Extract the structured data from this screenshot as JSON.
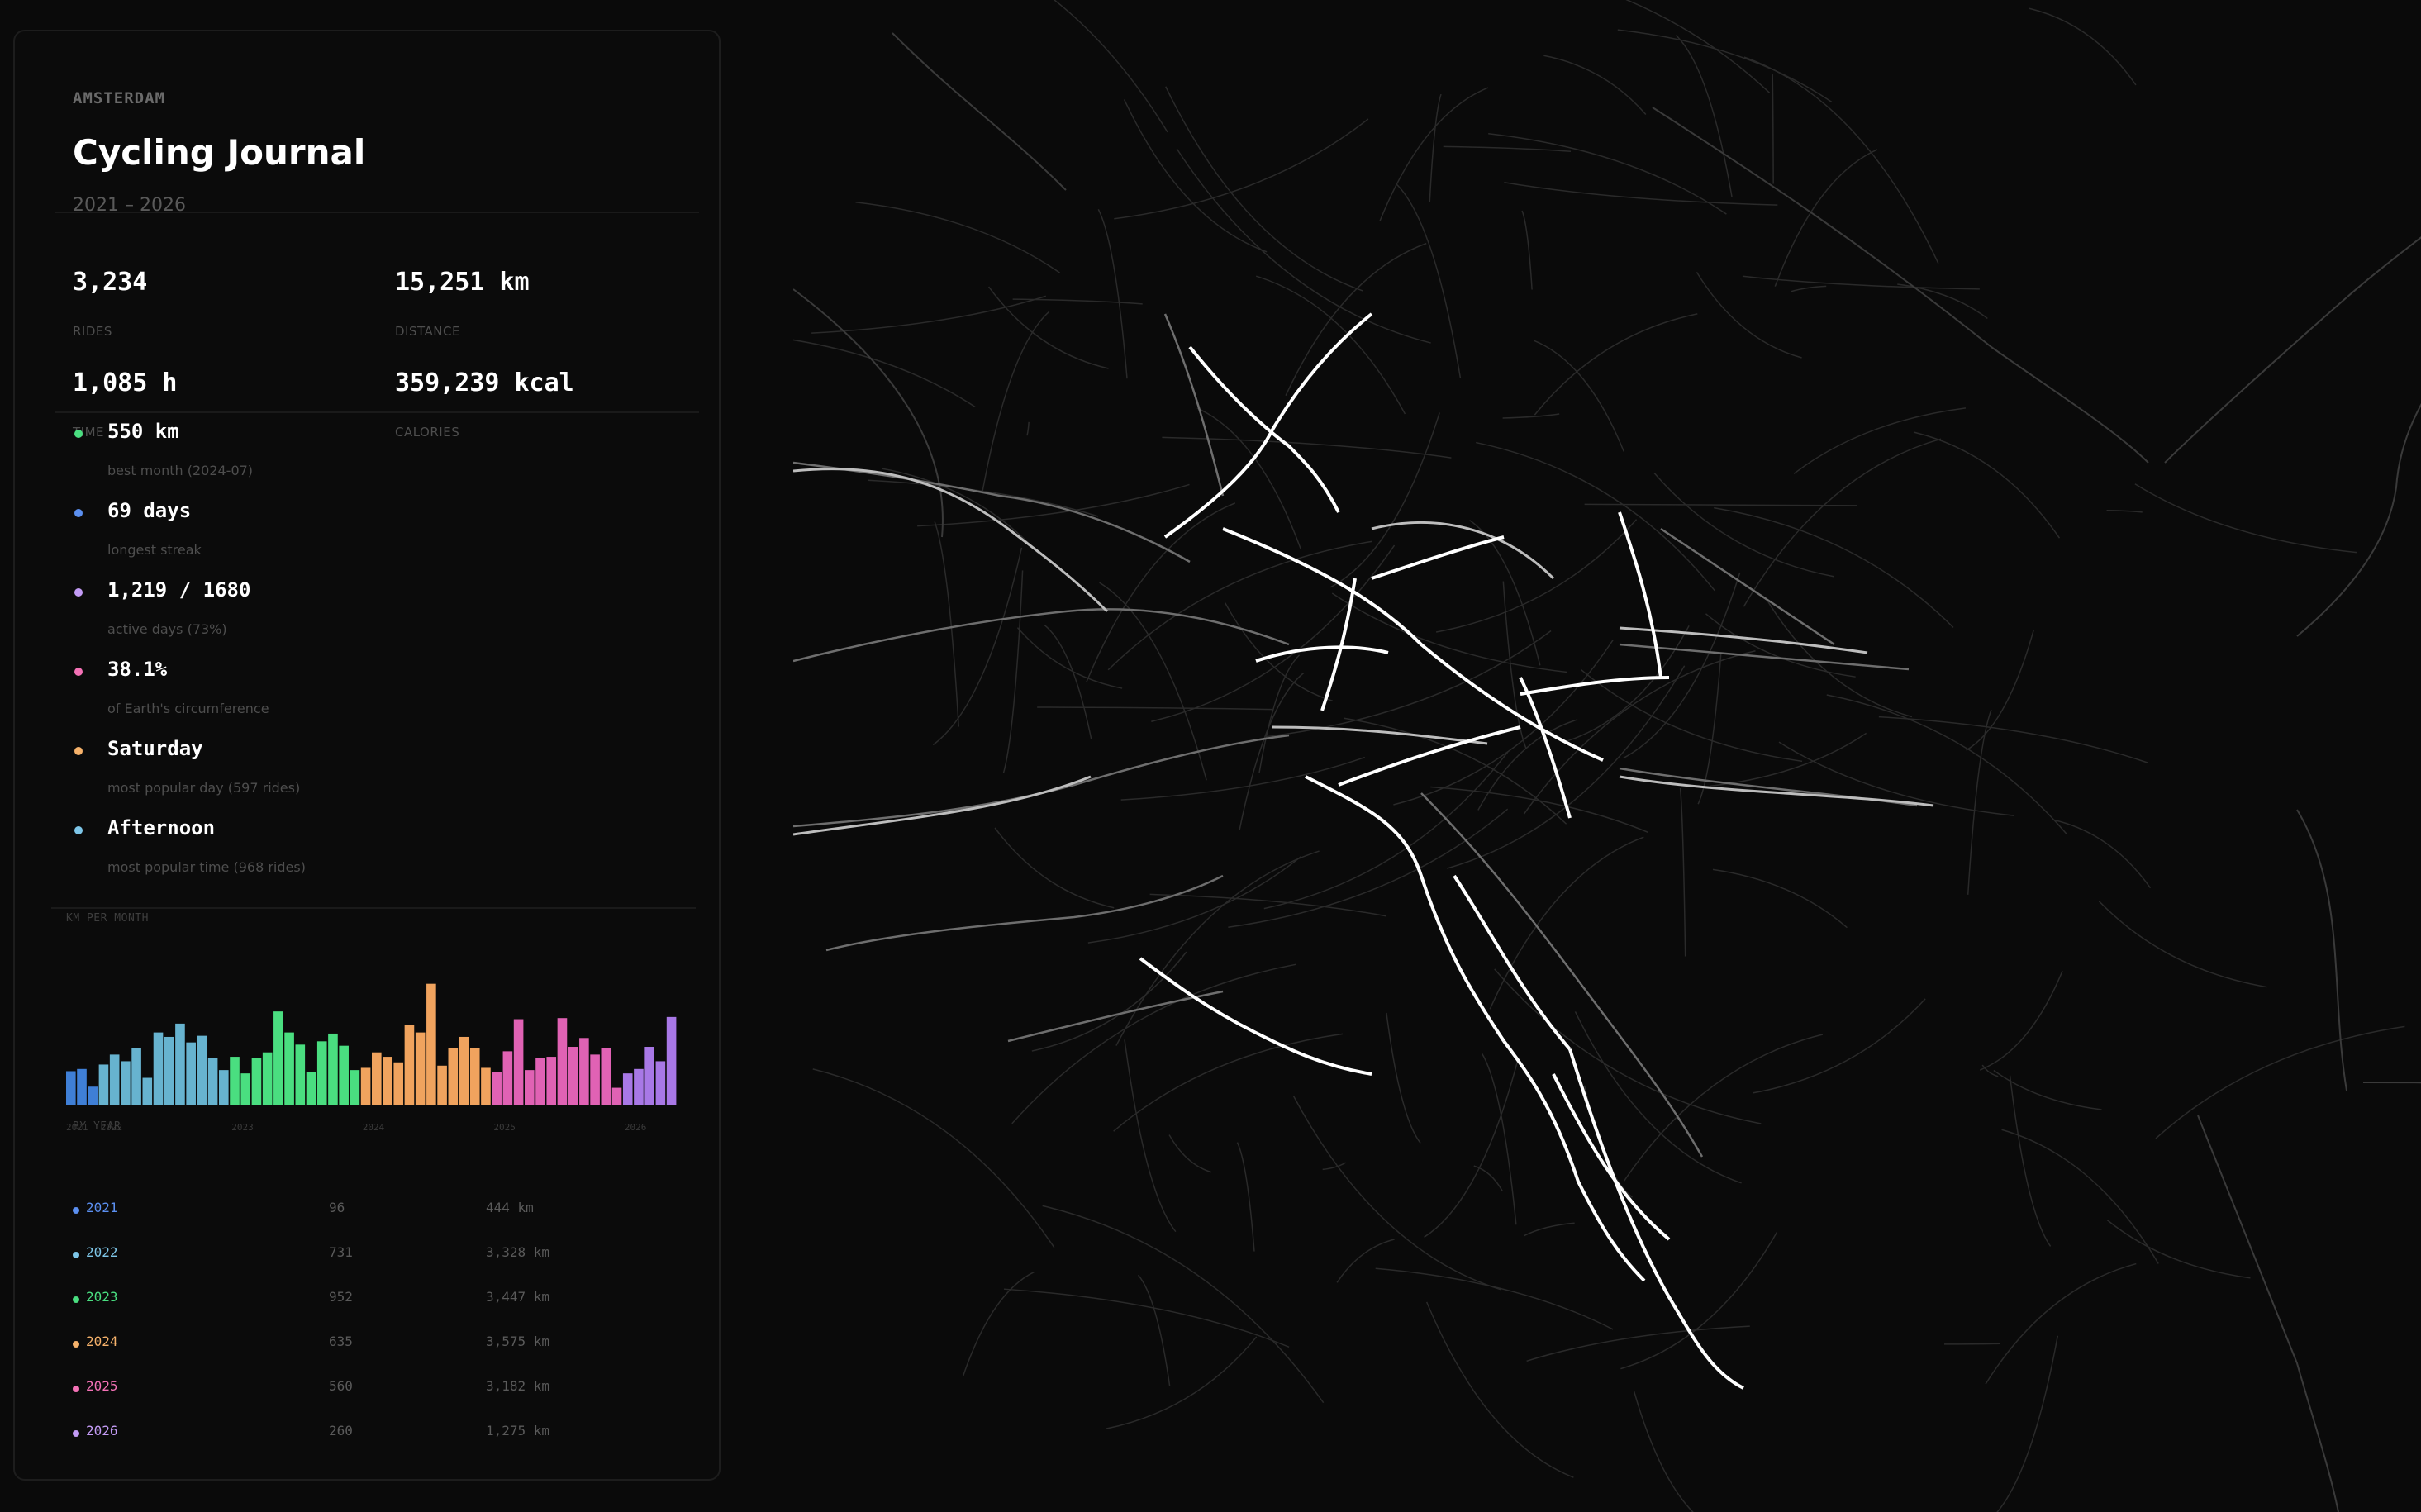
{
  "panel": {
    "city": "AMSTERDAM",
    "title": "Cycling Journal",
    "period": "2021 – 2026"
  },
  "stats": [
    {
      "value": "3,234",
      "label": "RIDES"
    },
    {
      "value": "15,251 km",
      "label": "DISTANCE"
    },
    {
      "value": "1,085 h",
      "label": "TIME"
    },
    {
      "value": "359,239 kcal",
      "label": "CALORIES"
    }
  ],
  "highlights": [
    {
      "value": "550 km",
      "label": "best month  (2024-07)",
      "color": "#4ade80"
    },
    {
      "value": "69 days",
      "label": "longest streak",
      "color": "#5b8ff0"
    },
    {
      "value": "1,219 / 1680",
      "label": "active days  (73%)",
      "color": "#c39bf5"
    },
    {
      "value": "38.1%",
      "label": "of Earth's circumference",
      "color": "#f472b6"
    },
    {
      "value": "Saturday",
      "label": "most popular day  (597 rides)",
      "color": "#f6b26b"
    },
    {
      "value": "Afternoon",
      "label": "most popular time  (968 rides)",
      "color": "#7ec6e8"
    }
  ],
  "monthly_section_label": "KM PER MONTH",
  "chart_data": {
    "type": "bar",
    "title": "KM PER MONTH",
    "x_tick_labels": [
      "2021",
      "2022",
      "2023",
      "2024",
      "2025",
      "2026"
    ],
    "series": [
      {
        "year": "2021",
        "color": "#3f7fd6",
        "values": [
          155,
          165,
          85
        ]
      },
      {
        "year": "2022",
        "color": "#67b3cf",
        "values": [
          185,
          230,
          200,
          260,
          125,
          330,
          310,
          370,
          285,
          315,
          215,
          160
        ]
      },
      {
        "year": "2023",
        "color": "#4ade80",
        "values": [
          220,
          145,
          215,
          240,
          425,
          330,
          275,
          150,
          290,
          325,
          270,
          160
        ]
      },
      {
        "year": "2024",
        "color": "#f0a35e",
        "values": [
          170,
          240,
          220,
          195,
          365,
          330,
          550,
          180,
          260,
          310,
          260,
          170
        ]
      },
      {
        "year": "2025",
        "color": "#e062b4",
        "values": [
          150,
          245,
          390,
          160,
          215,
          220,
          395,
          265,
          305,
          230,
          260,
          80
        ]
      },
      {
        "year": "2026",
        "color": "#a878e6",
        "values": [
          145,
          165,
          265,
          200,
          400
        ]
      }
    ],
    "ylim": [
      0,
      560
    ]
  },
  "by_year_label": "BY YEAR",
  "years": [
    {
      "year": "2021",
      "rides": "96",
      "km": "444 km",
      "color": "#5b8ff0"
    },
    {
      "year": "2022",
      "rides": "731",
      "km": "3,328 km",
      "color": "#7ec6e8"
    },
    {
      "year": "2023",
      "rides": "952",
      "km": "3,447 km",
      "color": "#4ade80"
    },
    {
      "year": "2024",
      "rides": "635",
      "km": "3,575 km",
      "color": "#f6b26b"
    },
    {
      "year": "2025",
      "rides": "560",
      "km": "3,182 km",
      "color": "#f472b6"
    },
    {
      "year": "2026",
      "rides": "260",
      "km": "1,275 km",
      "color": "#c39bf5"
    }
  ]
}
